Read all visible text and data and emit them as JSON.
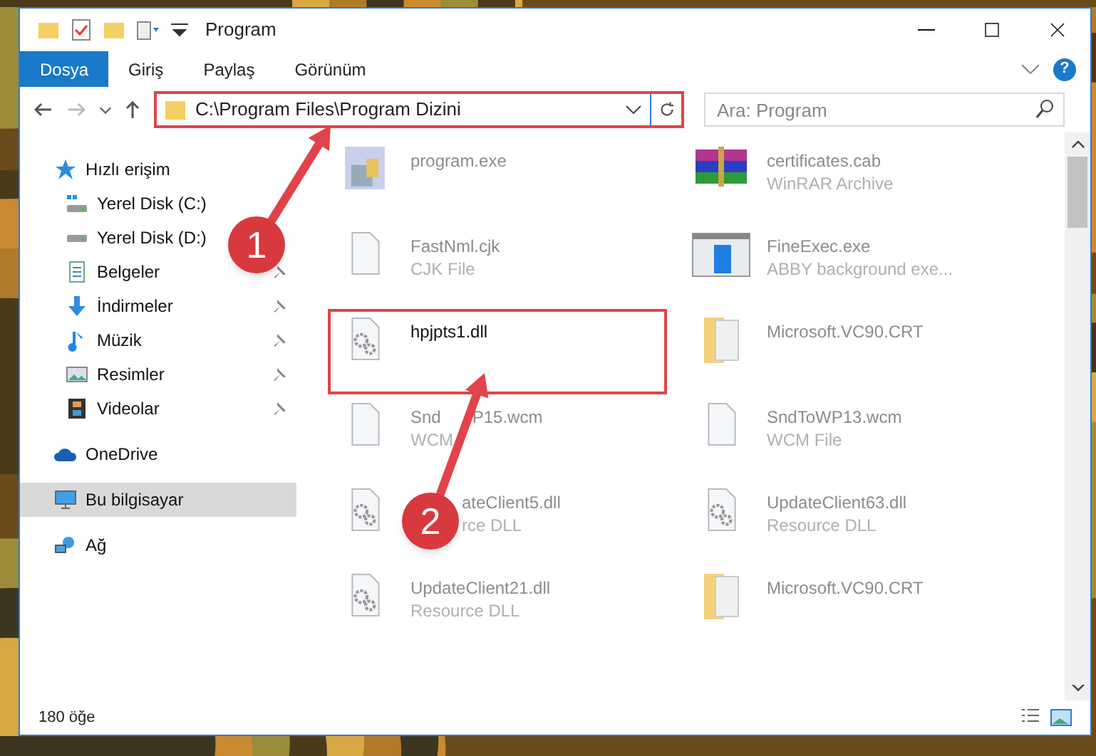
{
  "window": {
    "title": "Program"
  },
  "ribbon": {
    "tabs": [
      {
        "label": "Dosya",
        "selected": true
      },
      {
        "label": "Giriş",
        "selected": false
      },
      {
        "label": "Paylaş",
        "selected": false
      },
      {
        "label": "Görünüm",
        "selected": false
      }
    ],
    "help": "?"
  },
  "address": {
    "path": "C:\\Program Files\\Program Dizini",
    "highlighted": true
  },
  "search": {
    "placeholder": "Ara: Program"
  },
  "sidebar": {
    "items": [
      {
        "label": "Hızlı erişim",
        "kind": "star",
        "pinned": false,
        "selected": false
      },
      {
        "label": "Yerel Disk (C:)",
        "kind": "drive-c",
        "pinned": false,
        "selected": false
      },
      {
        "label": "Yerel Disk (D:)",
        "kind": "drive",
        "pinned": false,
        "selected": false
      },
      {
        "label": "Belgeler",
        "kind": "docs",
        "pinned": true,
        "selected": false
      },
      {
        "label": "İndirmeler",
        "kind": "download",
        "pinned": true,
        "selected": false
      },
      {
        "label": "Müzik",
        "kind": "music",
        "pinned": true,
        "selected": false
      },
      {
        "label": "Resimler",
        "kind": "pictures",
        "pinned": true,
        "selected": false
      },
      {
        "label": "Videolar",
        "kind": "videos",
        "pinned": true,
        "selected": false
      },
      {
        "label": "OneDrive",
        "kind": "cloud",
        "pinned": false,
        "selected": false
      },
      {
        "label": "Bu bilgisayar",
        "kind": "pc",
        "pinned": false,
        "selected": true
      },
      {
        "label": "Ağ",
        "kind": "network",
        "pinned": false,
        "selected": false
      }
    ]
  },
  "files": [
    {
      "name_parts": [
        "program.exe"
      ],
      "kind": "exe",
      "highlighted": false
    },
    {
      "name_parts": [
        "certificates.cab"
      ],
      "type_parts": [
        "WinRAR Archive"
      ],
      "kind": "cab",
      "highlighted": false
    },
    {
      "name_parts": [
        "FastNml.cjk"
      ],
      "type_parts": [
        "CJK File"
      ],
      "kind": "blank",
      "highlighted": false
    },
    {
      "name_parts": [
        "FineExec.exe"
      ],
      "type_parts": [
        "ABBY background exe..."
      ],
      "kind": "app",
      "highlighted": false
    },
    {
      "name_parts": [
        "hpjpts1.dll"
      ],
      "kind": "dll",
      "highlighted": true
    },
    {
      "name_parts": [
        "Microsoft.VC90.CRT"
      ],
      "kind": "folder",
      "highlighted": false
    },
    {
      "name_parts": [
        "Snd",
        "P15.wcm"
      ],
      "type_parts": [
        "WCM"
      ],
      "kind": "blank",
      "highlighted": false
    },
    {
      "name_parts": [
        "SndToWP13.wcm"
      ],
      "type_parts": [
        "WCM File"
      ],
      "kind": "blank",
      "highlighted": false
    },
    {
      "name_parts": [
        "ateClient5.dll"
      ],
      "type_parts": [
        "rce DLL"
      ],
      "hidden_start": true,
      "kind": "dll",
      "highlighted": false
    },
    {
      "name_parts": [
        "UpdateClient63.dll"
      ],
      "type_parts": [
        "Resource DLL"
      ],
      "kind": "dll",
      "highlighted": false
    },
    {
      "name_parts": [
        "UpdateClient21.dll"
      ],
      "type_parts": [
        "Resource DLL"
      ],
      "kind": "dll",
      "highlighted": false
    },
    {
      "name_parts": [
        "Microsoft.VC90.CRT"
      ],
      "kind": "folder",
      "highlighted": false
    }
  ],
  "annotations": [
    {
      "label": "1"
    },
    {
      "label": "2"
    }
  ],
  "status_bar": {
    "count": "180 öğe"
  }
}
